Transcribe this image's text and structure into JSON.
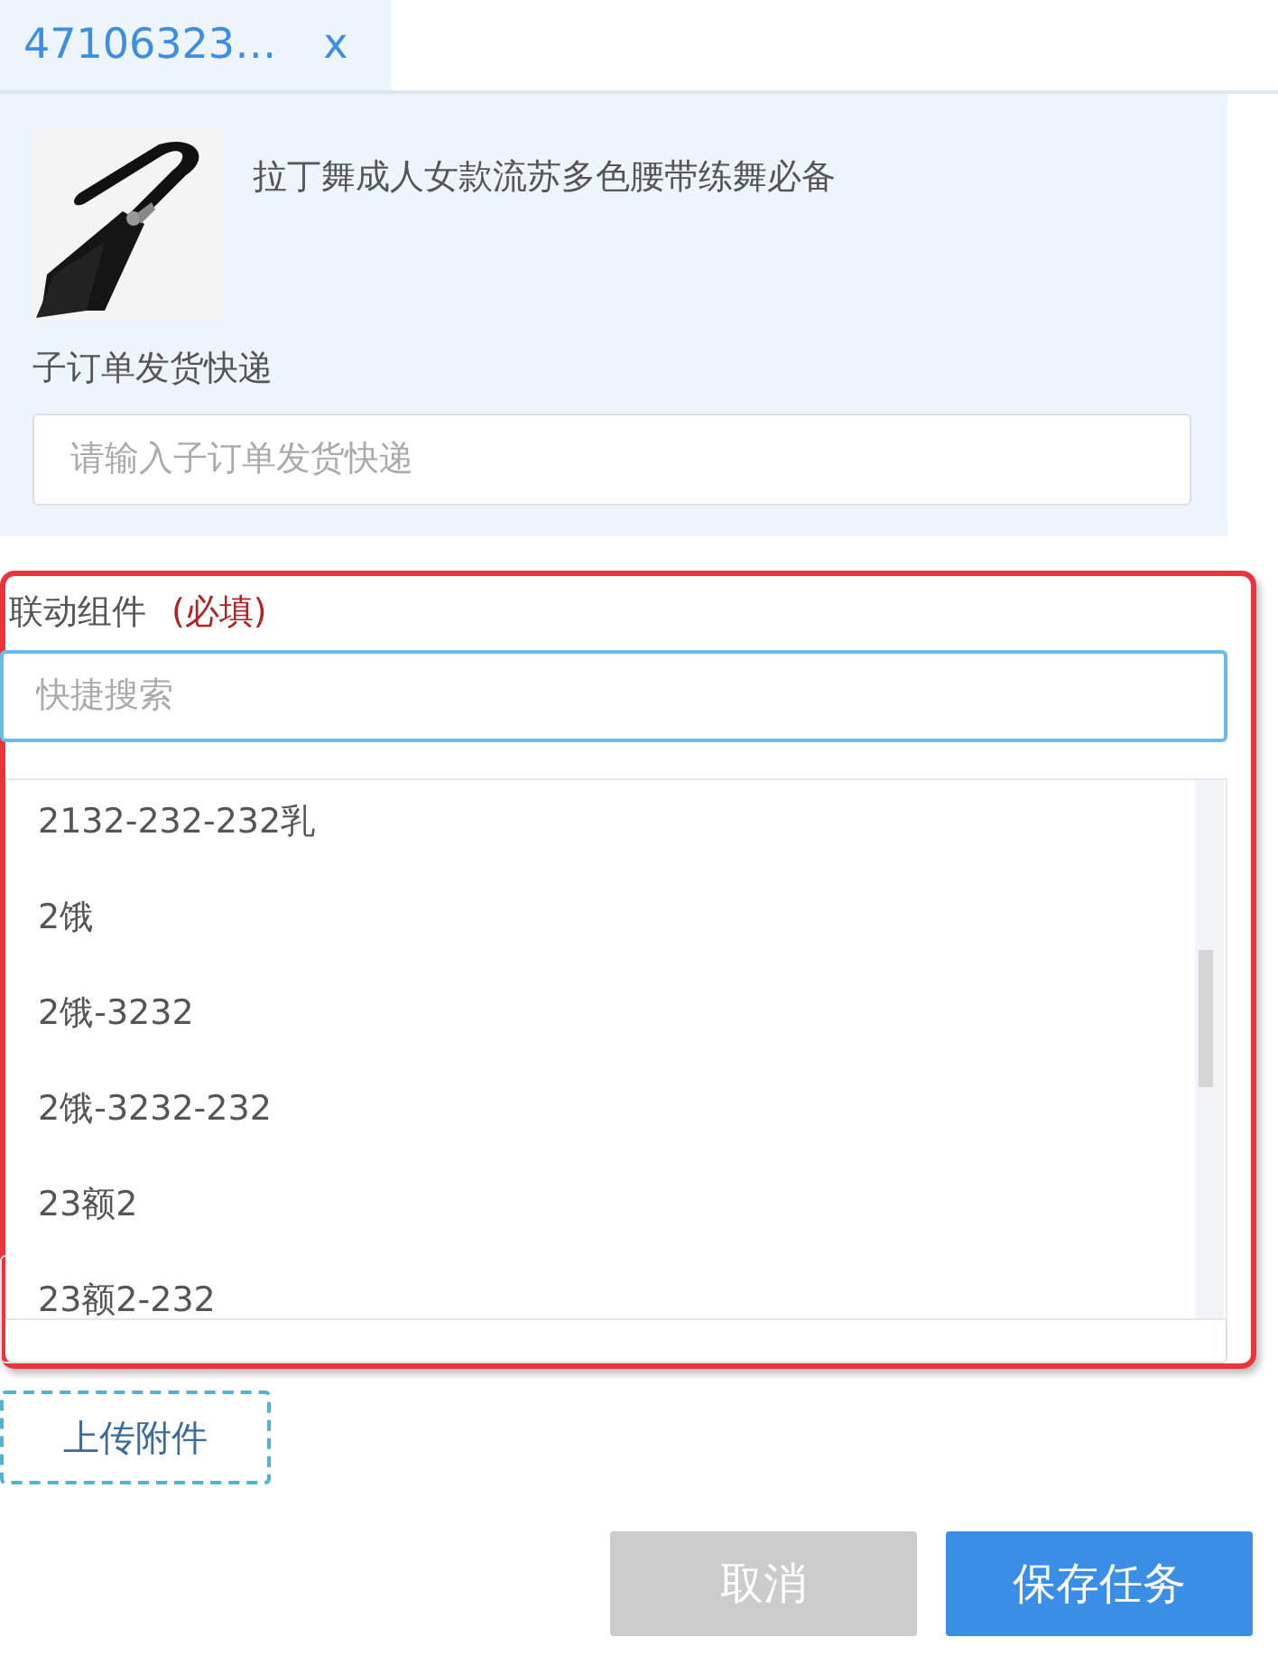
{
  "tab": {
    "label": "47106323…",
    "close": "x"
  },
  "product": {
    "kind": "picture",
    "title": "拉丁舞成人女款流苏多色腰带练舞必备"
  },
  "courier_field": {
    "label": "子订单发货快递",
    "placeholder": "请输入子订单发货快递"
  },
  "linked_component": {
    "label": "联动组件",
    "required": "(必填)",
    "search_placeholder": "快捷搜索",
    "options": [
      {
        "label": "2132-232-232乳"
      },
      {
        "label": "2饿"
      },
      {
        "label": "2饿-3232"
      },
      {
        "label": "2饿-3232-232"
      },
      {
        "label": "23额2"
      },
      {
        "label": "23额2-232"
      }
    ]
  },
  "upload_button": "上传附件",
  "buttons": [
    {
      "label": "取消",
      "kind": "secondary"
    },
    {
      "label": "保存任务",
      "kind": "primary"
    }
  ]
}
